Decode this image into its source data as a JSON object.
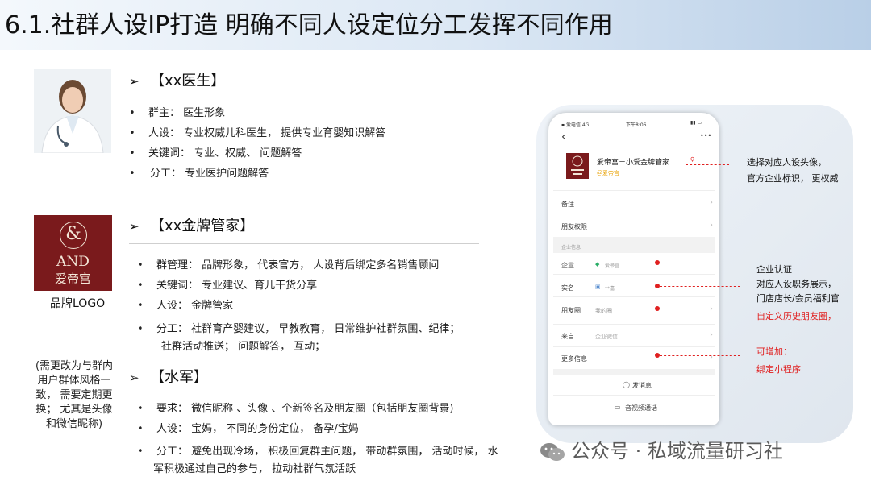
{
  "title": "6.1.社群人设IP打造 明确不同人设定位分工发挥不同作用",
  "sections": {
    "doctor": {
      "heading": "【xx医生】",
      "items": [
        "群主： 医生形象",
        "人设： 专业权威儿科医生， 提供专业育婴知识解答",
        "关键词： 专业、权威、 问题解答",
        "分工： 专业医护问题解答"
      ]
    },
    "butler": {
      "heading": "【xx金牌管家】",
      "items": [
        "群管理： 品牌形象， 代表官方， 人设背后绑定多名销售顾问",
        "关键词： 专业建议、育儿干货分享",
        "人设： 金牌管家",
        "分工： 社群育产婴建议， 早教教育， 日常维护社群氛围、纪律；",
        "社群活动推送； 问题解答， 互动；"
      ]
    },
    "army": {
      "heading": "【水军】",
      "items": [
        "要求： 微信昵称 、头像 、个新签名及朋友圈（包括朋友圈背景)",
        "人设： 宝妈， 不同的身份定位， 备孕/宝妈",
        "分工： 避免出现冷场， 积极回复群主问题， 带动群氛围， 活动时候， 水",
        "军积极通过自己的参与， 拉动社群气氛活跃"
      ]
    }
  },
  "logo": {
    "mark": "&",
    "name_en": "AND",
    "name_cn": "爱帝宫",
    "caption": "品牌LOGO"
  },
  "side_note": "(需更改为与群内用户群体风格一致， 需要定期更换； 尤其是头像和微信昵称)",
  "phone": {
    "status_left": "▪ 爱电信 4G",
    "status_time": "下午8:06",
    "back": "‹",
    "more": "•••",
    "profile_name": "爱帝宫－小爱金牌管家",
    "profile_badge": "＠爱帝宫",
    "rows": [
      {
        "label": "备注",
        "value": ""
      },
      {
        "label": "朋友权限",
        "value": ""
      }
    ],
    "section_header": "企业信息",
    "info_rows": [
      {
        "label": "企业",
        "value": "爱帝宫"
      },
      {
        "label": "实名",
        "value": "**嘉"
      },
      {
        "label": "朋友圈",
        "value": "我的圈"
      }
    ],
    "source_label": "来自",
    "source_value": "企业微信",
    "more_info": "更多信息",
    "send_message": "发消息",
    "video_call": "音视频通话"
  },
  "annotations": {
    "avatar": [
      "选择对应人设头像，",
      "官方企业标识， 更权威"
    ],
    "enterprise": [
      "企业认证",
      "对应人设职务展示，",
      "门店店长/会员福利官"
    ],
    "moments": "自定义历史朋友圈，",
    "more": [
      "可增加：",
      "绑定小程序"
    ]
  },
  "watermark": "公众号 · 私域流量研习社",
  "colors": {
    "accent_red": "#e02020",
    "brand_maroon": "#7a1a1c",
    "title_band": "#b9cfe7"
  }
}
